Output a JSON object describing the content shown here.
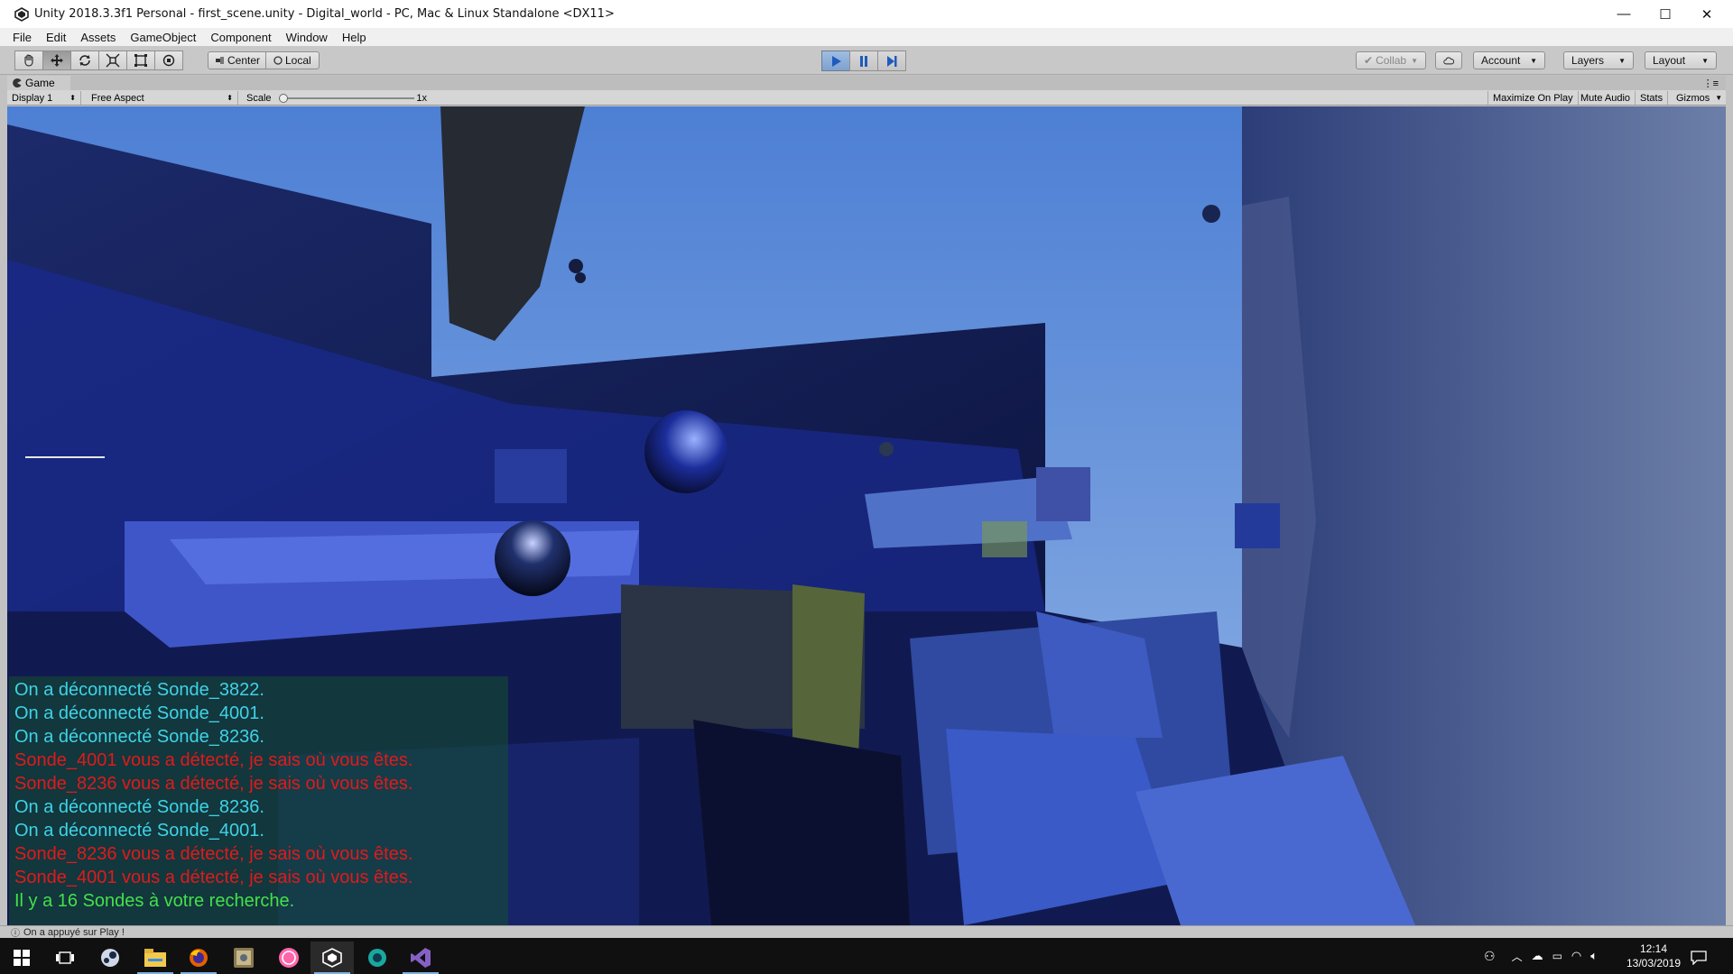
{
  "window": {
    "title": "Unity 2018.3.3f1 Personal - first_scene.unity - Digital_world - PC, Mac & Linux Standalone <DX11>",
    "controls": {
      "minimize": "—",
      "maximize": "☐",
      "close": "✕"
    }
  },
  "menu": [
    "File",
    "Edit",
    "Assets",
    "GameObject",
    "Component",
    "Window",
    "Help"
  ],
  "toolbar": {
    "transform_tools": [
      "hand-icon",
      "move-icon",
      "rotate-icon",
      "scale-icon",
      "rect-icon",
      "transform-icon"
    ],
    "pivot_label": "Center",
    "space_label": "Local",
    "collab_label": "Collab",
    "account_label": "Account",
    "layers_label": "Layers",
    "layout_label": "Layout",
    "accent_color": "#5b8fd6"
  },
  "game_view": {
    "tab_label": "Game",
    "display_label": "Display 1",
    "aspect_label": "Free Aspect",
    "scale_label": "Scale",
    "scale_value": "1x",
    "maximize_label": "Maximize On Play",
    "mute_label": "Mute Audio",
    "stats_label": "Stats",
    "gizmos_label": "Gizmos"
  },
  "console": {
    "lines": [
      {
        "text": "On a déconnecté Sonde_3822.",
        "color": "#3fd3e6"
      },
      {
        "text": "On a déconnecté Sonde_4001.",
        "color": "#3fd3e6"
      },
      {
        "text": "On a déconnecté Sonde_8236.",
        "color": "#3fd3e6"
      },
      {
        "text": "Sonde_4001 vous a détecté, je sais où vous êtes.",
        "color": "#e01a1a"
      },
      {
        "text": "Sonde_8236 vous a détecté, je sais où vous êtes.",
        "color": "#e01a1a"
      },
      {
        "text": "On a déconnecté Sonde_8236.",
        "color": "#3fd3e6"
      },
      {
        "text": "On a déconnecté Sonde_4001.",
        "color": "#3fd3e6"
      },
      {
        "text": "Sonde_8236 vous a détecté, je sais où vous êtes.",
        "color": "#e01a1a"
      },
      {
        "text": "Sonde_4001 vous a détecté, je sais où vous êtes.",
        "color": "#e01a1a"
      },
      {
        "text": "Il y a 16 Sondes à votre recherche.",
        "color": "#44e04a"
      }
    ]
  },
  "status": {
    "message": "On a appuyé sur Play !"
  },
  "taskbar": {
    "apps": [
      "windows-start-icon",
      "task-view-icon",
      "steam-icon",
      "file-explorer-icon",
      "firefox-icon",
      "photo-app-icon",
      "osu-icon",
      "unity-icon",
      "globe-app-icon",
      "visual-studio-icon"
    ],
    "time": "12:14",
    "date": "13/03/2019"
  }
}
